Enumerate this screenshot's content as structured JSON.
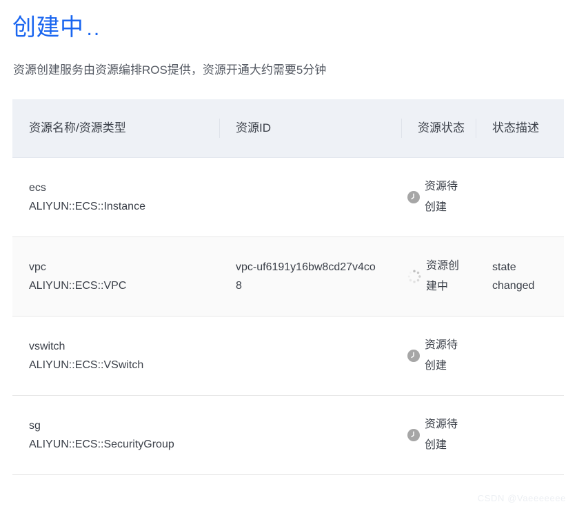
{
  "header": {
    "title": "创建中",
    "title_dots": "..",
    "title_color": "#1a66f0",
    "subtitle": "资源创建服务由资源编排ROS提供，资源开通大约需要5分钟"
  },
  "table": {
    "columns": [
      {
        "key": "name",
        "label": "资源名称/资源类型"
      },
      {
        "key": "id",
        "label": "资源ID"
      },
      {
        "key": "state",
        "label": "资源状态"
      },
      {
        "key": "desc",
        "label": "状态描述"
      }
    ],
    "rows": [
      {
        "resource_name": "ecs",
        "resource_type": "ALIYUN::ECS::Instance",
        "resource_id": "",
        "status_icon": "clock-icon",
        "status_text": "资源待创建",
        "status_description": ""
      },
      {
        "resource_name": "vpc",
        "resource_type": "ALIYUN::ECS::VPC",
        "resource_id": "vpc-uf6191y16bw8cd27v4co8",
        "status_icon": "spinner-icon",
        "status_text": "资源创建中",
        "status_description": "state changed"
      },
      {
        "resource_name": "vswitch",
        "resource_type": "ALIYUN::ECS::VSwitch",
        "resource_id": "",
        "status_icon": "clock-icon",
        "status_text": "资源待创建",
        "status_description": ""
      },
      {
        "resource_name": "sg",
        "resource_type": "ALIYUN::ECS::SecurityGroup",
        "resource_id": "",
        "status_icon": "clock-icon",
        "status_text": "资源待创建",
        "status_description": ""
      }
    ]
  },
  "watermark": "CSDN  @Vaeeeeeee"
}
